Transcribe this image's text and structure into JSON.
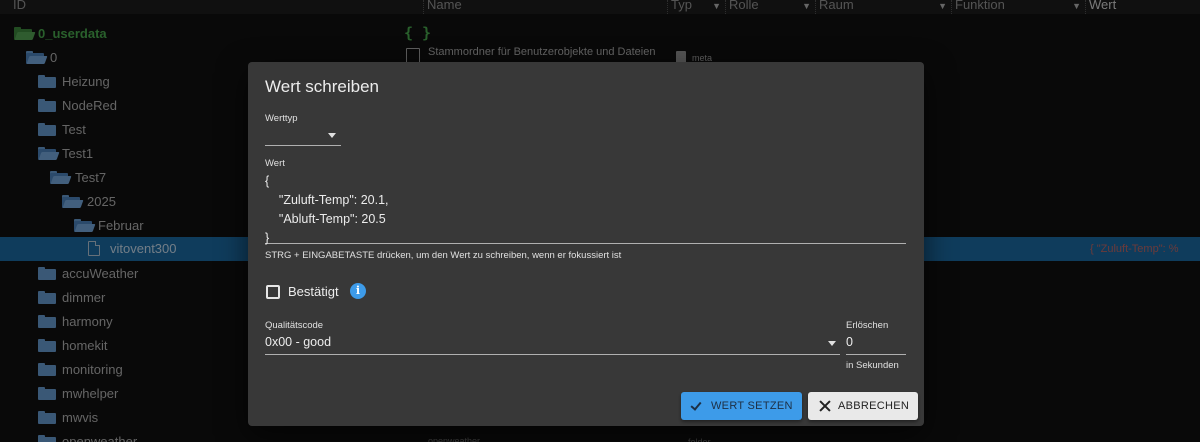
{
  "header": {
    "columns": [
      "ID",
      "Name",
      "Typ",
      "Rolle",
      "Raum",
      "Funktion",
      "Wert"
    ]
  },
  "tree": {
    "items": [
      {
        "label": "0_userdata"
      },
      {
        "label": "0"
      },
      {
        "label": "Heizung"
      },
      {
        "label": "NodeRed"
      },
      {
        "label": "Test"
      },
      {
        "label": "Test1"
      },
      {
        "label": "Test7"
      },
      {
        "label": "2025"
      },
      {
        "label": "Februar"
      },
      {
        "label": "vitovent300"
      },
      {
        "label": "accuWeather"
      },
      {
        "label": "dimmer"
      },
      {
        "label": "harmony"
      },
      {
        "label": "homekit"
      },
      {
        "label": "monitoring"
      },
      {
        "label": "mwhelper"
      },
      {
        "label": "mwvis"
      },
      {
        "label": "openweather"
      }
    ],
    "root_braces": "{ }",
    "root_description": "Stammordner für Benutzerobjekte und Dateien",
    "meta_label": "meta",
    "selected_value": "{ \"Zuluft-Temp\": %",
    "bottom_name": "openweather",
    "bottom_type": "folder"
  },
  "dialog": {
    "title": "Wert schreiben",
    "type_label": "Werttyp",
    "type_value": "",
    "value_label": "Wert",
    "value_lines": [
      "{",
      "    \"Zuluft-Temp\": 20.1,",
      "    \"Abluft-Temp\": 20.5",
      "}"
    ],
    "hint": "STRG + EINGABETASTE drücken, um den Wert zu schreiben, wenn er fokussiert ist",
    "ack_label": "Bestätigt",
    "ack_checked": false,
    "quality_label": "Qualitätscode",
    "quality_value": "0x00 - good",
    "expire_label": "Erlöschen",
    "expire_value": "0",
    "expire_helper": "in Sekunden",
    "submit_label": "WERT SETZEN",
    "cancel_label": "ABBRECHEN"
  },
  "colors": {
    "primary": "#3d9be9",
    "dialog_bg": "#383838",
    "selected_row": "#1d6ea8",
    "green": "#4caf50"
  }
}
